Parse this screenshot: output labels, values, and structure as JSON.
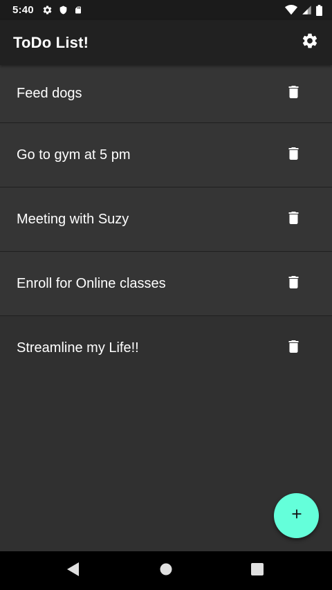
{
  "status_bar": {
    "time": "5:40",
    "left_icons": [
      "gear-icon",
      "shield-icon",
      "sd-card-icon"
    ],
    "right_icons": [
      "wifi-icon",
      "signal-icon",
      "battery-icon"
    ]
  },
  "app_bar": {
    "title": "ToDo List!",
    "settings_icon": "gear-icon"
  },
  "todos": [
    {
      "text": "Feed dogs"
    },
    {
      "text": "Go to gym at 5 pm"
    },
    {
      "text": "Meeting with Suzy"
    },
    {
      "text": "Enroll for Online classes"
    },
    {
      "text": "Streamline my Life!!"
    }
  ],
  "fab": {
    "icon": "plus-icon",
    "color": "#64ffda"
  },
  "nav_bar": {
    "buttons": [
      "back-icon",
      "home-icon",
      "recents-icon"
    ]
  },
  "colors": {
    "background": "#303030",
    "app_bar": "#212121",
    "item": "#353535",
    "accent": "#64ffda"
  }
}
